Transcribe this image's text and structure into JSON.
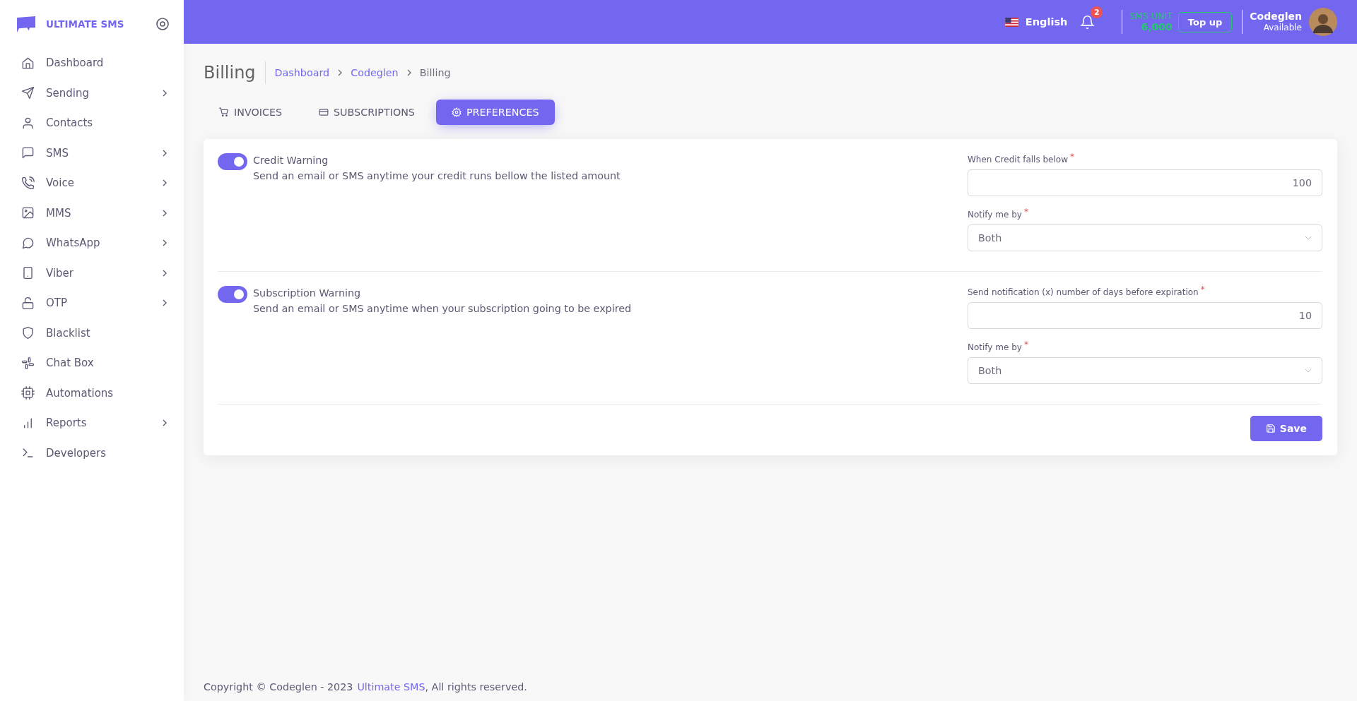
{
  "brand": {
    "name": "ULTIMATE SMS"
  },
  "sidebar": {
    "items": [
      {
        "label": "Dashboard",
        "expandable": false
      },
      {
        "label": "Sending",
        "expandable": true
      },
      {
        "label": "Contacts",
        "expandable": false
      },
      {
        "label": "SMS",
        "expandable": true
      },
      {
        "label": "Voice",
        "expandable": true
      },
      {
        "label": "MMS",
        "expandable": true
      },
      {
        "label": "WhatsApp",
        "expandable": true
      },
      {
        "label": "Viber",
        "expandable": true
      },
      {
        "label": "OTP",
        "expandable": true
      },
      {
        "label": "Blacklist",
        "expandable": false
      },
      {
        "label": "Chat Box",
        "expandable": false
      },
      {
        "label": "Automations",
        "expandable": false
      },
      {
        "label": "Reports",
        "expandable": true
      },
      {
        "label": "Developers",
        "expandable": false
      }
    ]
  },
  "topbar": {
    "language": "English",
    "notification_count": "2",
    "sms_unit_label": "SMS UNIT",
    "sms_unit_value": "6,000",
    "top_up": "Top up",
    "user_name": "Codeglen",
    "user_status": "Available"
  },
  "page": {
    "title": "Billing",
    "breadcrumb": [
      {
        "label": "Dashboard",
        "link": true
      },
      {
        "label": "Codeglen",
        "link": true
      },
      {
        "label": "Billing",
        "link": false
      }
    ]
  },
  "tabs": [
    {
      "label": "INVOICES",
      "selected": false
    },
    {
      "label": "SUBSCRIPTIONS",
      "selected": false
    },
    {
      "label": "PREFERENCES",
      "selected": true
    }
  ],
  "sections": [
    {
      "title": "Credit Warning",
      "description": "Send an email or SMS anytime your credit runs bellow the listed amount",
      "on": true,
      "fields": [
        {
          "kind": "input",
          "label": "When Credit falls below",
          "required_mark": "*",
          "value": "100"
        },
        {
          "kind": "select",
          "label": "Notify me by",
          "required_mark": "*",
          "value": "Both"
        }
      ]
    },
    {
      "title": "Subscription Warning",
      "description": "Send an email or SMS anytime when your subscription going to be expired",
      "on": true,
      "fields": [
        {
          "kind": "input",
          "label": "Send notification (x) number of days before expiration",
          "required_mark": "*",
          "value": "10"
        },
        {
          "kind": "select",
          "label": "Notify me by",
          "required_mark": "*",
          "value": "Both"
        }
      ]
    }
  ],
  "save_button": "Save",
  "footer": {
    "text": "Copyright © Codeglen - 2023",
    "link": "Ultimate SMS",
    "suffix": ", All rights reserved."
  }
}
